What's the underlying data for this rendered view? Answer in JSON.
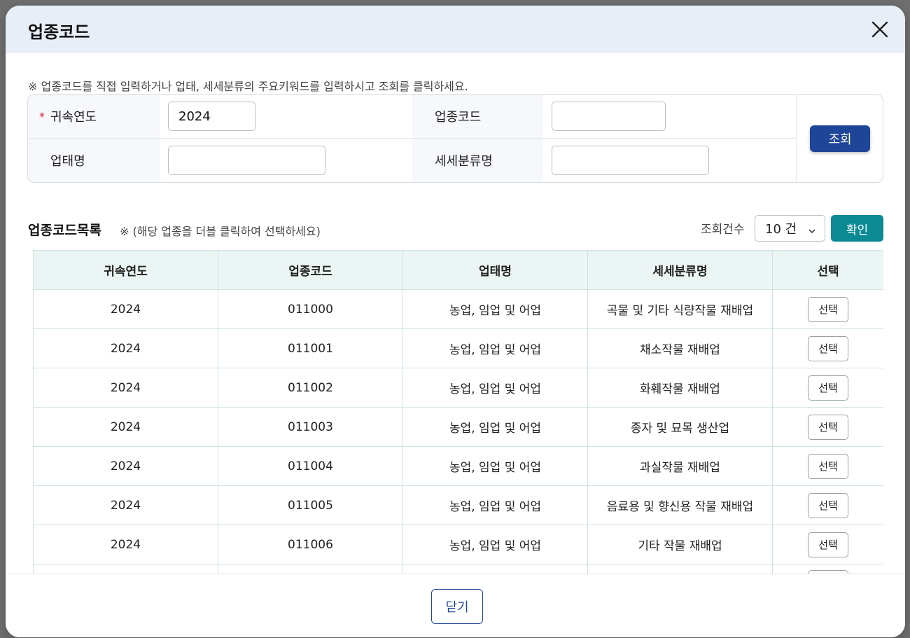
{
  "modal": {
    "title": "업종코드",
    "notice": "※ 업종코드를 직접 입력하거나 업태, 세세분류의 주요키워드를 입력하시고 조회를 클릭하세요."
  },
  "search": {
    "year_label": "귀속연도",
    "required_mark": "*",
    "year_value": "2024",
    "code_label": "업종코드",
    "code_value": "",
    "business_label": "업태명",
    "business_value": "",
    "subclass_label": "세세분류명",
    "subclass_value": "",
    "search_button": "조회"
  },
  "list": {
    "title": "업종코드목록",
    "hint": "※ (해당 업종을 더블 클릭하여 선택하세요)",
    "count_label": "조회건수",
    "count_value": "10 건",
    "confirm_button": "확인",
    "columns": [
      "귀속연도",
      "업종코드",
      "업태명",
      "세세분류명",
      "선택"
    ],
    "rows": [
      {
        "year": "2024",
        "code": "011000",
        "business": "농업, 임업 및 어업",
        "subclass": "곡물 및 기타 식량작물 재배업",
        "action": "선택"
      },
      {
        "year": "2024",
        "code": "011001",
        "business": "농업, 임업 및 어업",
        "subclass": "채소작물 재배업",
        "action": "선택"
      },
      {
        "year": "2024",
        "code": "011002",
        "business": "농업, 임업 및 어업",
        "subclass": "화훼작물 재배업",
        "action": "선택"
      },
      {
        "year": "2024",
        "code": "011003",
        "business": "농업, 임업 및 어업",
        "subclass": "종자 및 묘목 생산업",
        "action": "선택"
      },
      {
        "year": "2024",
        "code": "011004",
        "business": "농업, 임업 및 어업",
        "subclass": "과실작물 재배업",
        "action": "선택"
      },
      {
        "year": "2024",
        "code": "011005",
        "business": "농업, 임업 및 어업",
        "subclass": "음료용 및 향신용 작물 재배업",
        "action": "선택"
      },
      {
        "year": "2024",
        "code": "011006",
        "business": "농업, 임업 및 어업",
        "subclass": "기타 작물 재배업",
        "action": "선택"
      },
      {
        "year": "",
        "code": "",
        "business": "",
        "subclass": "",
        "action": ""
      }
    ]
  },
  "footer": {
    "close_button": "닫기"
  },
  "icons": {
    "close": "close-icon",
    "chevron": "chevron-down-icon"
  },
  "colors": {
    "primary": "#1f4599",
    "teal": "#0c8a93",
    "header_bg": "#e8eef8",
    "table_head_bg": "#ebf5f3"
  }
}
